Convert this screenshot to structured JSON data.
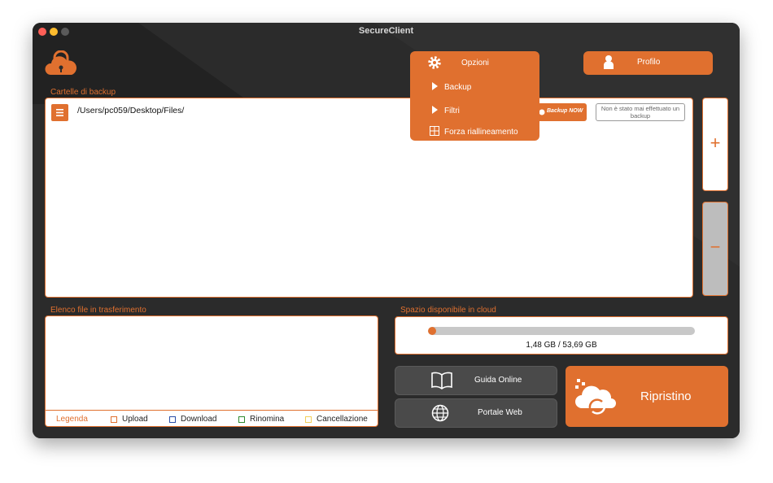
{
  "window": {
    "title": "SecureClient"
  },
  "header": {
    "options_menu": {
      "title": "Opzioni",
      "items": [
        {
          "label": "Backup",
          "icon": "triangle-right-icon"
        },
        {
          "label": "Filtri",
          "icon": "triangle-right-icon"
        },
        {
          "label": "Forza riallineamento",
          "icon": "realign-icon"
        }
      ]
    },
    "profile_label": "Profilo"
  },
  "backup": {
    "section_label": "Cartelle di backup",
    "folders": [
      {
        "path": "/Users/pc059/Desktop/Files/",
        "backup_now_label": "Backup NOW",
        "status": "Non è stato mai effettuato un backup"
      }
    ],
    "add_label": "+",
    "remove_label": "−"
  },
  "transfers": {
    "section_label": "Elenco file in trasferimento",
    "legend": {
      "title": "Legenda",
      "items": [
        {
          "label": "Upload",
          "color": "#e0702f"
        },
        {
          "label": "Download",
          "color": "#2a4fa8"
        },
        {
          "label": "Rinomina",
          "color": "#2f8a2f"
        },
        {
          "label": "Cancellazione",
          "color": "#f2cf5a"
        }
      ]
    }
  },
  "storage": {
    "section_label": "Spazio disponibile in cloud",
    "usage_text": "1,48 GB / 53,69 GB",
    "used_fraction": 0.028
  },
  "links": {
    "guide_label": "Guida Online",
    "portal_label": "Portale Web"
  },
  "restore": {
    "label": "Ripristino"
  },
  "colors": {
    "accent": "#e0702f",
    "background": "#2b2b2b",
    "dark_button": "#4a4a4a"
  }
}
